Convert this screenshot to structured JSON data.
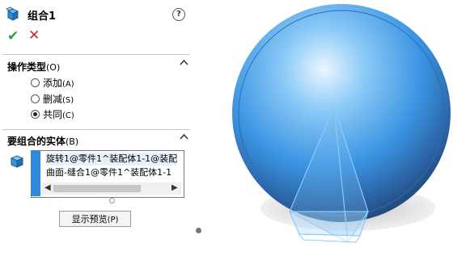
{
  "feature": {
    "title": "组合1",
    "help": "?"
  },
  "actions": {
    "ok": "✔",
    "cancel": "✕"
  },
  "operation_section": {
    "title": "操作类型",
    "shortcut": "(O)",
    "options": [
      {
        "label": "添加",
        "shortcut": "(A)",
        "selected": false
      },
      {
        "label": "删减",
        "shortcut": "(S)",
        "selected": false
      },
      {
        "label": "共同",
        "shortcut": "(C)",
        "selected": true
      }
    ]
  },
  "bodies_section": {
    "title": "要组合的实体",
    "shortcut": "(B)",
    "items": [
      "旋转1@零件1^装配体1-1@装配",
      "曲面-缝合1@零件1^装配体1-1"
    ]
  },
  "preview_button": {
    "label": "显示预览",
    "shortcut": "(P)"
  },
  "colors": {
    "accent": "#2f8ad8",
    "ok_green": "#2e9e2e",
    "cancel_red": "#d42424",
    "sphere": "#4aa8f0",
    "shadow": "#dadada"
  },
  "icons": {
    "feature": "combine-feature-icon",
    "bodies": "solid-body-icon",
    "collapse": "chevron-up-icon"
  }
}
